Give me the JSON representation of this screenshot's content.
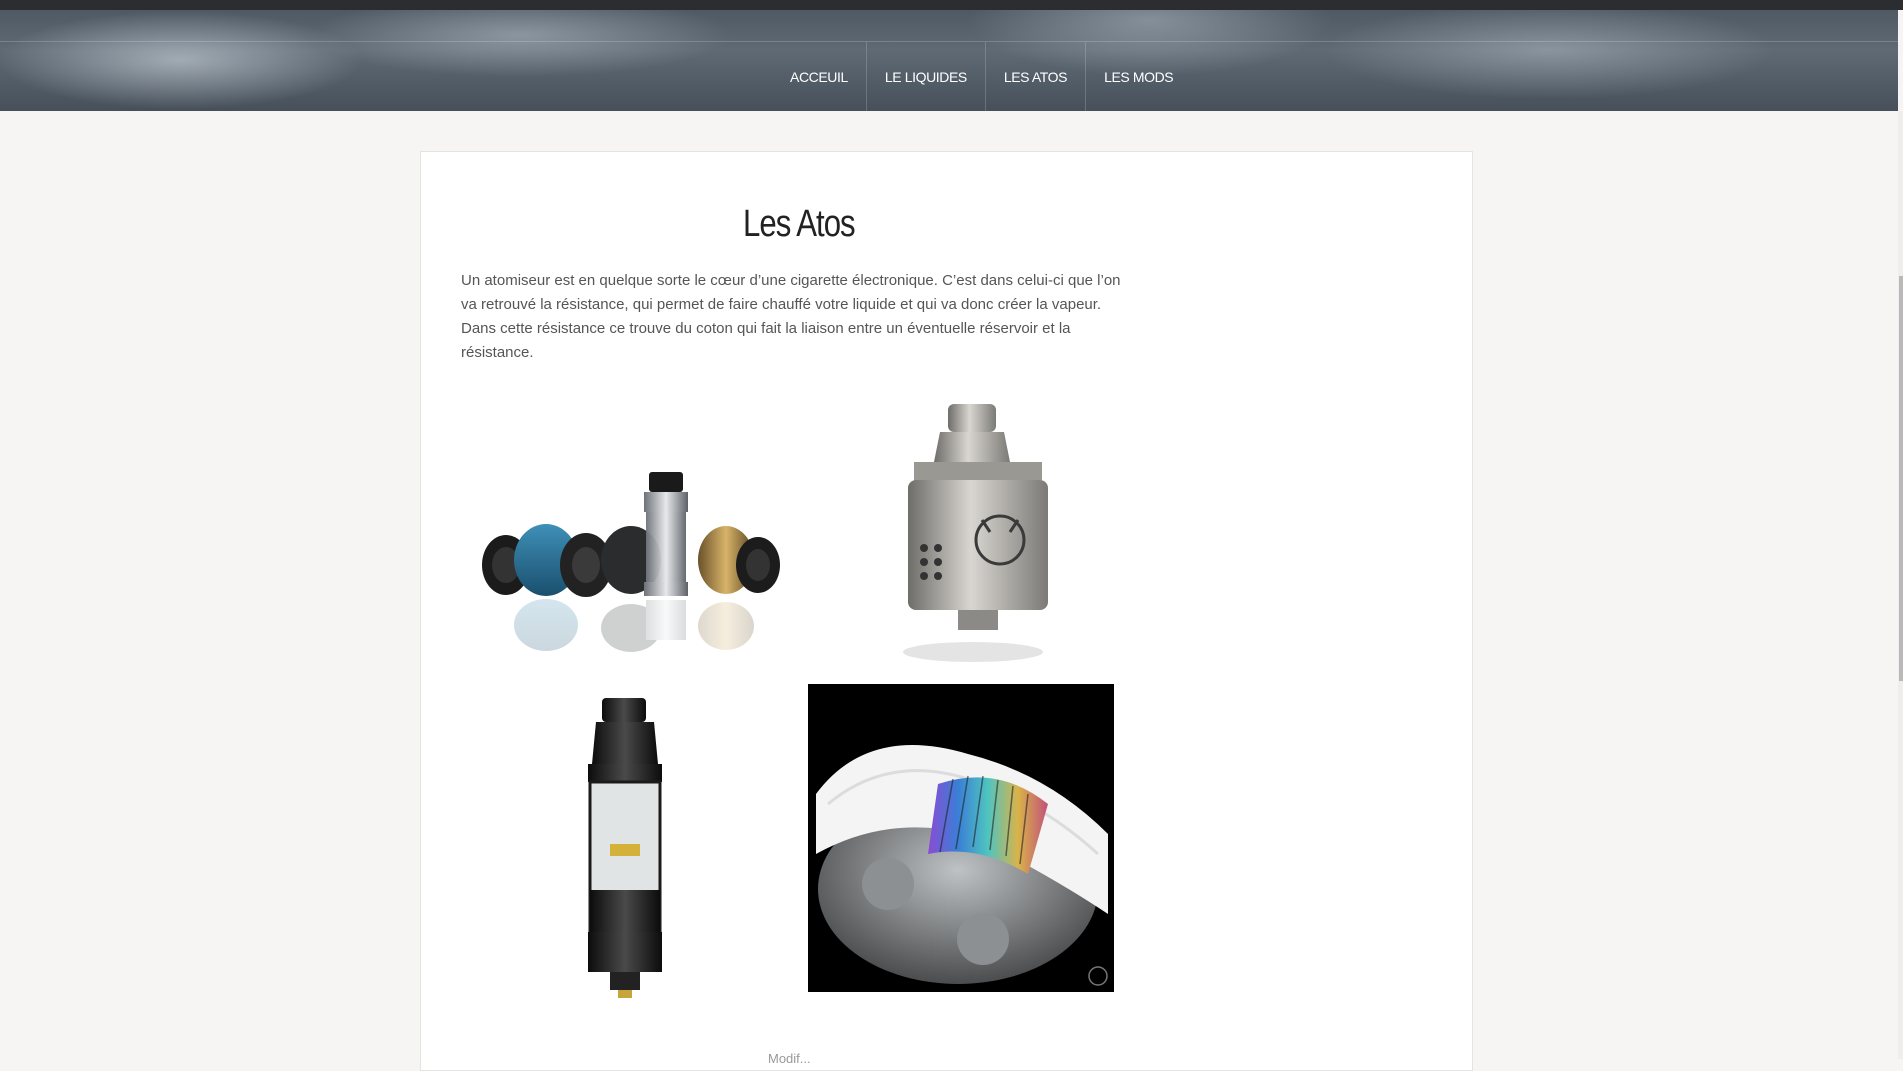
{
  "nav": {
    "items": [
      "ACCEUIL",
      "LE LIQUIDES",
      "LES ATOS",
      "LES MODS"
    ]
  },
  "page": {
    "title": "Les Atos",
    "intro": "Un atomiseur est en quelque sorte le cœur d’une cigarette électronique. C’est dans celui-ci que l’on va retrouvé la résistance, qui permet de faire chauffé votre liquide et qui va donc créer la vapeur. Dans cette résistance ce trouve du coton qui fait la liaison entre un éventuelle réservoir et la résistance.",
    "footer_partial": "Modif..."
  },
  "images": [
    {
      "icon": "atomizer-group-image"
    },
    {
      "icon": "steel-rda-image"
    },
    {
      "icon": "navigator-rta-image"
    },
    {
      "icon": "coil-cotton-image"
    }
  ],
  "colors": {
    "header": "#55606b",
    "card": "#ffffff",
    "page_bg": "#f7f5f4"
  }
}
